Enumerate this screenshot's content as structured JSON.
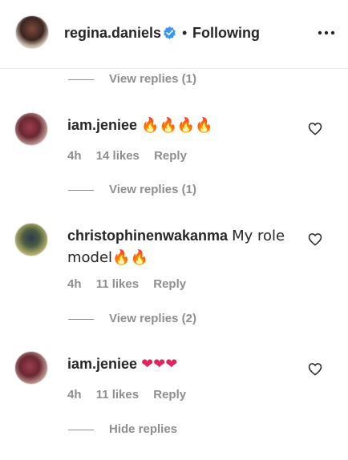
{
  "header": {
    "username": "regina.daniels",
    "separator": "•",
    "follow_status": "Following"
  },
  "view_replies": [
    {
      "label": "View replies (1)"
    },
    {
      "label": "View replies (1)"
    },
    {
      "label": "View replies (2)"
    },
    {
      "label": "Hide replies"
    }
  ],
  "comments": [
    {
      "username": "iam.jeniee",
      "text": "🔥🔥🔥🔥",
      "time": "4h",
      "likes": "14 likes",
      "reply": "Reply",
      "avatar_icon": "user-avatar"
    },
    {
      "username": "christophinenwakanma",
      "text": "My role model🔥🔥",
      "time": "4h",
      "likes": "11 likes",
      "reply": "Reply",
      "avatar_icon": "user-avatar"
    },
    {
      "username": "iam.jeniee",
      "text": "❤❤❤",
      "time": "4h",
      "likes": "11 likes",
      "reply": "Reply",
      "avatar_icon": "user-avatar"
    }
  ],
  "colors": {
    "text_primary": "#262626",
    "text_secondary": "#8e8e8e",
    "verified_blue": "#3897f0",
    "heart_red": "#e0245e",
    "fire_orange": "#f58220"
  }
}
